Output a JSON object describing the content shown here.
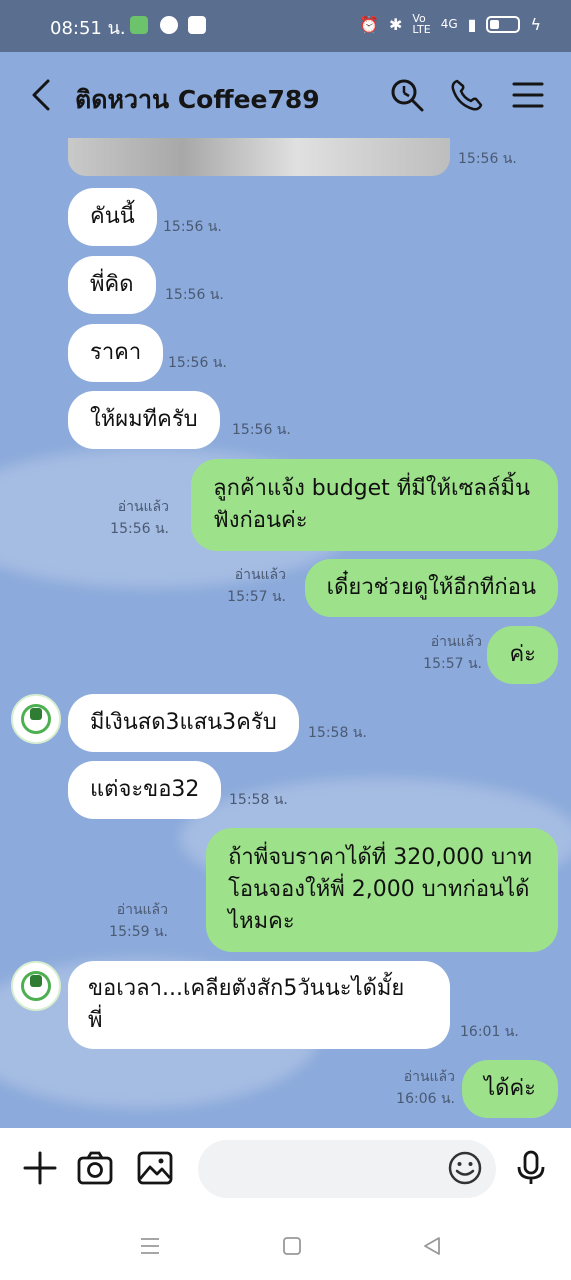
{
  "status_bar": {
    "time": "08:51 น.",
    "network": "4G",
    "icons": [
      "line-app-icon",
      "chat-bubble-icon",
      "facebook-icon",
      "alarm-icon",
      "bluetooth-icon",
      "volte-icon",
      "signal-icon",
      "battery-icon",
      "charging-icon"
    ]
  },
  "header": {
    "title": "ติดหวาน Coffee789",
    "icons": [
      "back-icon",
      "search-icon",
      "phone-icon",
      "menu-icon"
    ]
  },
  "messages": [
    {
      "dir": "in",
      "type": "image",
      "time": "15:56 น."
    },
    {
      "dir": "in",
      "text": "คันนี้",
      "time": "15:56 น."
    },
    {
      "dir": "in",
      "text": "พี่คิด",
      "time": "15:56 น."
    },
    {
      "dir": "in",
      "text": "ราคา",
      "time": "15:56 น."
    },
    {
      "dir": "in",
      "text": "ให้ผมทีครับ",
      "time": "15:56 น."
    },
    {
      "dir": "out",
      "lines": [
        "ลูกค้าแจ้ง budget ที่มีให้เซลล์มิ้น",
        "ฟังก่อนค่ะ"
      ],
      "read": "อ่านแล้ว",
      "time": "15:56 น."
    },
    {
      "dir": "out",
      "text": "เดี๋ยวช่วยดูให้อีกทีก่อน",
      "read": "อ่านแล้ว",
      "time": "15:57 น."
    },
    {
      "dir": "out",
      "text": "ค่ะ",
      "read": "อ่านแล้ว",
      "time": "15:57 น."
    },
    {
      "dir": "in",
      "text": "มีเงินสด3แสน3ครับ",
      "time": "15:58 น.",
      "avatar": true
    },
    {
      "dir": "in",
      "text": "แต่จะขอ32",
      "time": "15:58 น."
    },
    {
      "dir": "out",
      "lines": [
        "ถ้าพี่จบราคาได้ที่ 320,000 บาท",
        "โอนจองให้พี่ 2,000 บาทก่อนได้",
        "ไหมคะ"
      ],
      "read": "อ่านแล้ว",
      "time": "15:59 น."
    },
    {
      "dir": "in",
      "lines": [
        "ขอเวลา...เคลียตังสัก5วันนะได้มั้ย",
        "พี่"
      ],
      "time": "16:01 น.",
      "avatar": true
    },
    {
      "dir": "out",
      "text": "ได้ค่ะ",
      "read": "อ่านแล้ว",
      "time": "16:06 น."
    }
  ],
  "input_bar": {
    "placeholder": "",
    "icons": [
      "plus-icon",
      "camera-icon",
      "image-icon",
      "emoji-icon",
      "microphone-icon"
    ]
  },
  "colors": {
    "chat_bg": "#8caadb",
    "outgoing_bubble": "#9de28a",
    "incoming_bubble": "#ffffff",
    "status_bar": "#5a6e8f"
  }
}
